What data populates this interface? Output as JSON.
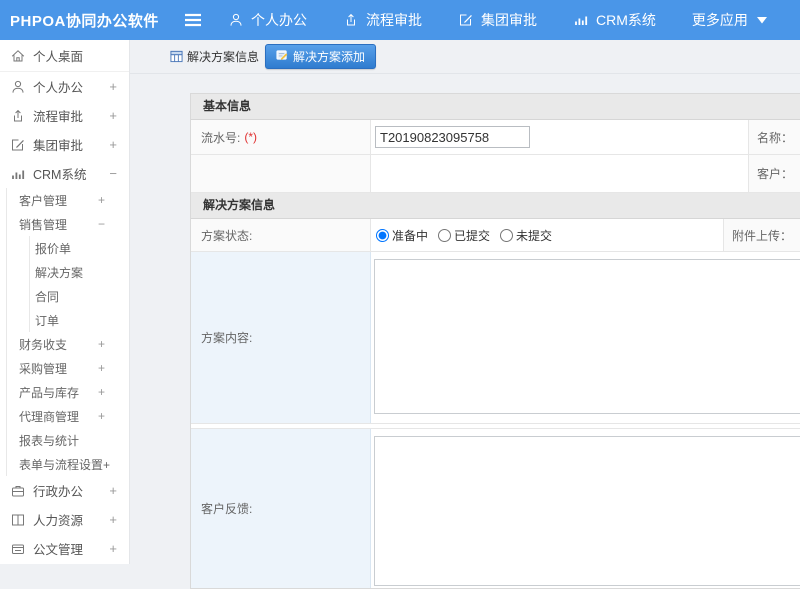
{
  "topbar": {
    "logo": "PHPOA协同办公软件",
    "menu_icon": "hamburger-menu-icon",
    "nav": [
      {
        "label": "个人办公",
        "icon": "user-icon"
      },
      {
        "label": "流程审批",
        "icon": "workflow-icon"
      },
      {
        "label": "集团审批",
        "icon": "edit-icon"
      },
      {
        "label": "CRM系统",
        "icon": "chart-icon"
      },
      {
        "label": "更多应用",
        "icon": "",
        "caret": true
      }
    ]
  },
  "sidebar": {
    "items": [
      {
        "label": "个人桌面",
        "icon": "home-icon",
        "level": 1,
        "expand": ""
      },
      {
        "label": "个人办公",
        "icon": "user-icon",
        "level": 1,
        "expand": "+"
      },
      {
        "label": "流程审批",
        "icon": "workflow-icon",
        "level": 1,
        "expand": "+"
      },
      {
        "label": "集团审批",
        "icon": "edit-icon",
        "level": 1,
        "expand": "+"
      },
      {
        "label": "CRM系统",
        "icon": "chart-icon",
        "level": 1,
        "expand": "−"
      },
      {
        "label": "客户管理",
        "level": 2,
        "expand": "+"
      },
      {
        "label": "销售管理",
        "level": 2,
        "expand": "−"
      },
      {
        "label": "报价单",
        "level": 3,
        "expand": ""
      },
      {
        "label": "解决方案",
        "level": 3,
        "expand": ""
      },
      {
        "label": "合同",
        "level": 3,
        "expand": ""
      },
      {
        "label": "订单",
        "level": 3,
        "expand": ""
      },
      {
        "label": "财务收支",
        "level": 2,
        "expand": "+"
      },
      {
        "label": "采购管理",
        "level": 2,
        "expand": "+"
      },
      {
        "label": "产品与库存",
        "level": 2,
        "expand": "+"
      },
      {
        "label": "代理商管理",
        "level": 2,
        "expand": "+"
      },
      {
        "label": "报表与统计",
        "level": 2,
        "expand": ""
      },
      {
        "label": "表单与流程设置+",
        "level": 2,
        "expand": ""
      },
      {
        "label": "行政办公",
        "icon": "briefcase-icon",
        "level": 1,
        "expand": "+"
      },
      {
        "label": "人力资源",
        "icon": "book-icon",
        "level": 1,
        "expand": "+"
      },
      {
        "label": "公文管理",
        "icon": "document-icon",
        "level": 1,
        "expand": "+"
      }
    ]
  },
  "tabs": {
    "info_tab": "解决方案信息",
    "add_tab": "解决方案添加"
  },
  "form": {
    "basic_section": "基本信息",
    "serial_label": "流水号:",
    "required_mark": "(*)",
    "serial_value": "T20190823095758",
    "name_label": "名称：",
    "customer_label": "客户：",
    "solution_section": "解决方案信息",
    "status_label": "方案状态:",
    "status_options": [
      {
        "label": "准备中",
        "checked": true
      },
      {
        "label": "已提交",
        "checked": false
      },
      {
        "label": "未提交",
        "checked": false
      }
    ],
    "attachment_label": "附件上传：",
    "content_label": "方案内容:",
    "feedback_label": "客户反馈:"
  },
  "colors": {
    "topbar_blue": "#4a96e8",
    "button_gradient_top": "#58a0ea",
    "button_gradient_bottom": "#2f7ccf",
    "page_background": "#eff1f4",
    "section_header_bg": "#e9e9e9",
    "label_cell_bg": "#fafafa",
    "blue_cell_bg": "#edf4fb",
    "required_red": "#e03131"
  }
}
